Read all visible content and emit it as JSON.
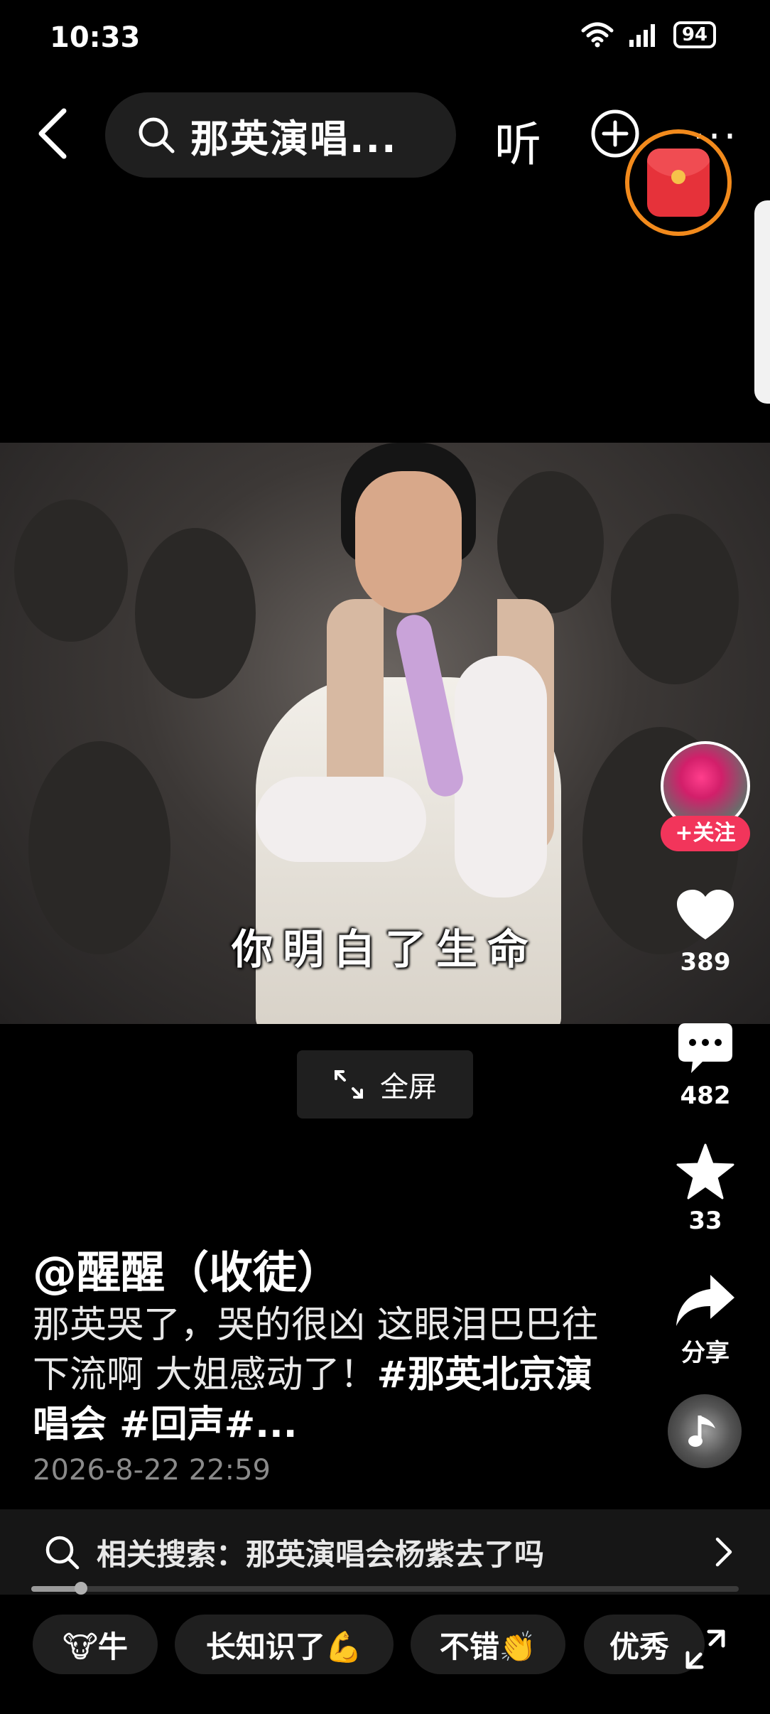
{
  "status_bar": {
    "time": "10:33",
    "battery": "94",
    "icons": [
      "wifi-icon",
      "signal-icon",
      "battery-icon"
    ]
  },
  "top_bar": {
    "search_text": "那英演唱...",
    "listen_label": "听",
    "more_label": "···",
    "icons": [
      "back-icon",
      "search-icon",
      "add-icon",
      "more-icon",
      "red-packet-icon"
    ],
    "red_packet_color": "#e6323a",
    "ring_color": "#f28a1c"
  },
  "video": {
    "subtitle": "你明白了生命",
    "fullscreen_label": "全屏"
  },
  "right_rail": {
    "follow_label": "+关注",
    "like_count": "389",
    "comment_count": "482",
    "favorite_count": "33",
    "share_label": "分享",
    "follow_color": "#f2355b"
  },
  "caption": {
    "author": "@醒醒（收徒）",
    "text": "那英哭了，哭的很凶 这眼泪巴巴往下流啊 大姐感动了！",
    "hashtags": "#那英北京演唱会 #回声#...",
    "date": "2026-8-22 22:59"
  },
  "related_search": {
    "label": "相关搜索：那英演唱会杨紫去了吗"
  },
  "progress": {
    "fraction": 0.07
  },
  "chips": [
    {
      "label": "🐮牛"
    },
    {
      "label": "长知识了💪"
    },
    {
      "label": "不错👏"
    },
    {
      "label": "优秀"
    }
  ]
}
